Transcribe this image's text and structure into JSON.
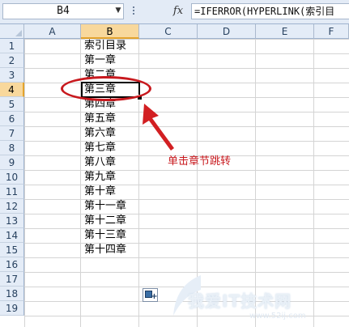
{
  "formula_bar": {
    "name_box": "B4",
    "fx_label": "fx",
    "formula": "=IFERROR(HYPERLINK(索引目"
  },
  "columns": [
    "A",
    "B",
    "C",
    "D",
    "E",
    "F"
  ],
  "selected_column": "B",
  "rows": [
    "1",
    "2",
    "3",
    "4",
    "5",
    "6",
    "7",
    "8",
    "9",
    "10",
    "11",
    "12",
    "13",
    "14",
    "15",
    "16",
    "17",
    "18",
    "19"
  ],
  "selected_row": "4",
  "cells_b": [
    "索引目录",
    "第一章",
    "第二章",
    "第三章",
    "第四章",
    "第五章",
    "第六章",
    "第七章",
    "第八章",
    "第九章",
    "第十章",
    "第十一章",
    "第十二章",
    "第十三章",
    "第十四章"
  ],
  "annotation": {
    "text": "单击章节跳转",
    "color": "#c8191e"
  },
  "watermark": {
    "text": "我爱IT技术网",
    "sub": "www.52ij.com"
  },
  "icons": {
    "paste_options": "paste-options-icon",
    "name_box_dropdown": "chevron-down-icon"
  }
}
